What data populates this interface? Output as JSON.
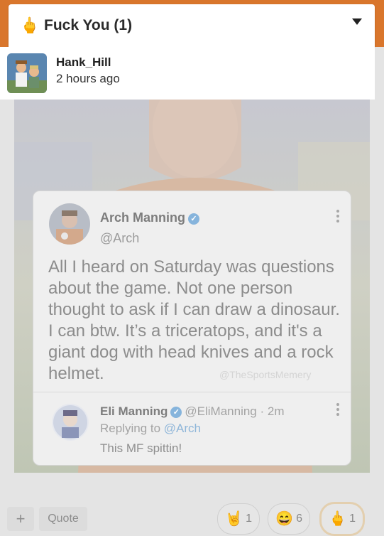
{
  "dropdown": {
    "emoji": "🖕",
    "title": "Fuck You (1)"
  },
  "user": {
    "name": "Hank_Hill",
    "time": "2 hours ago"
  },
  "tweet": {
    "name": "Arch Manning",
    "handle": "@Arch",
    "text": "All I heard on Saturday was questions about the game. Not one person thought to ask if I can draw a dinosaur. I can btw. It’s a triceratops, and it's a giant dog with head knives and a rock helmet.",
    "watermark": "@TheSportsMemery"
  },
  "reply": {
    "name": "Eli Manning",
    "handle": "@EliManning · 2m",
    "replying_prefix": "Replying to",
    "replying_to": "@Arch",
    "text": "This MF spittin!"
  },
  "actions": {
    "plus_label": "+",
    "quote_label": "Quote"
  },
  "reactions": [
    {
      "emoji": "🤘",
      "count": "1"
    },
    {
      "emoji": "😄",
      "count": "6"
    },
    {
      "emoji": "🖕",
      "count": "1"
    }
  ],
  "colors": {
    "accent": "#d9762c",
    "verified": "#86b4dc"
  }
}
